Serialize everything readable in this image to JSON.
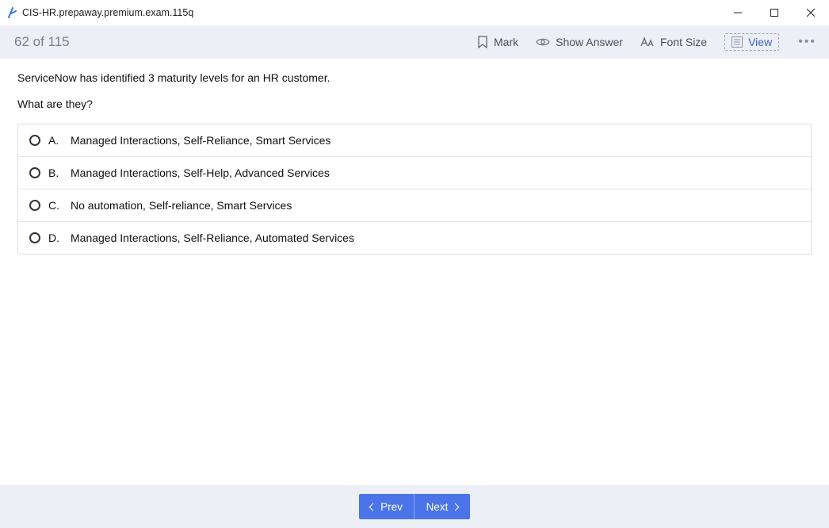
{
  "titlebar": {
    "title": "CIS-HR.prepaway.premium.exam.115q"
  },
  "toolbar": {
    "progress": "62 of 115",
    "mark": "Mark",
    "show_answer": "Show Answer",
    "font_size": "Font Size",
    "view": "View"
  },
  "question": {
    "line1": "ServiceNow has identified 3 maturity levels for an HR customer.",
    "line2": "What are they?"
  },
  "answers": [
    {
      "letter": "A.",
      "text": "Managed Interactions, Self-Reliance, Smart Services"
    },
    {
      "letter": "B.",
      "text": "Managed Interactions, Self-Help, Advanced Services"
    },
    {
      "letter": "C.",
      "text": "No automation, Self-reliance, Smart Services"
    },
    {
      "letter": "D.",
      "text": "Managed Interactions, Self-Reliance, Automated Services"
    }
  ],
  "footer": {
    "prev": "Prev",
    "next": "Next"
  }
}
